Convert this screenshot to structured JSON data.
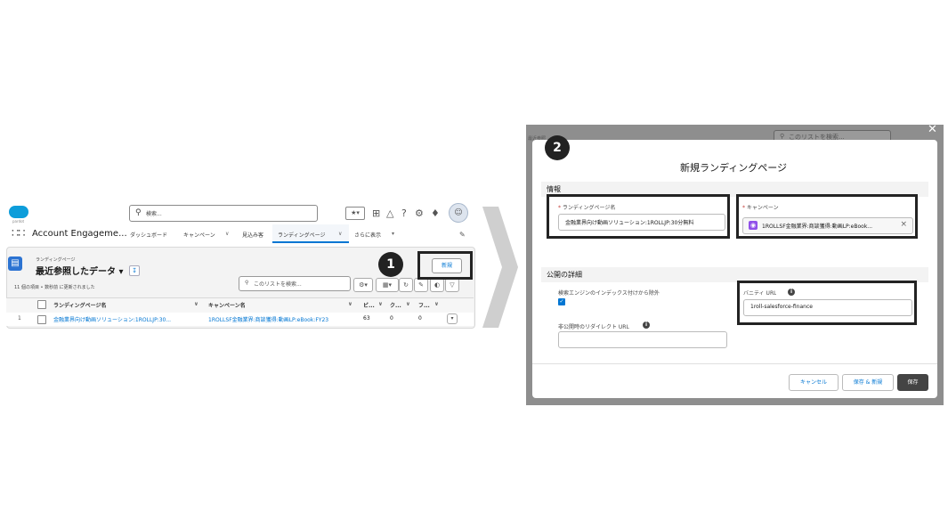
{
  "left_screenshot": {
    "logo_subtext": "pardot",
    "search_placeholder": "検索...",
    "favorites_icon": "star-icon",
    "app_name": "Account Engageme...",
    "nav_items": [
      "ダッシュボード",
      "キャンペーン",
      "見込み客",
      "ランディングページ",
      "さらに表示"
    ],
    "object_type": "ランディングページ",
    "list_view_title": "最近参照したデータ",
    "list_meta": "11 個の項目 • 数秒前 に更新されました",
    "list_search_placeholder": "このリストを検索...",
    "new_button": "新規",
    "step_badge": "1",
    "columns": [
      "ランディングページ名",
      "キャンペーン名",
      "ビ...",
      "ク...",
      "フ..."
    ],
    "rows": [
      {
        "index": "1",
        "name": "金融業界向け動画ソリューション:1ROLLJP:30...",
        "campaign": "1ROLLSF金融業界:商談獲得:動画LP:eBook:FY23",
        "views": "63",
        "clicks": "0",
        "forms": "0"
      }
    ]
  },
  "right_screenshot": {
    "step_badge": "2",
    "modal_title": "新規ランディングページ",
    "background_search_placeholder": "このリストを検索...",
    "background_row_label": "最近参照",
    "section_info": "情報",
    "landing_page_name_label": "ランディングページ名",
    "landing_page_name_value": "金融業界向け動画ソリューション:1ROLLJP:30分無料",
    "campaign_label": "キャンペーン",
    "campaign_value": "1ROLLSF金融業界:商談獲得:動画LP:eBook...",
    "section_publish": "公開の詳細",
    "exclude_search_label": "検索エンジンのインデックス付けから除外",
    "vanity_url_label": "バニティ URL",
    "vanity_url_value": "1roll-salesforce-finance",
    "redirect_url_label": "非公開時のリダイレクト URL",
    "cancel_button": "キャンセル",
    "save_new_button": "保存 & 新規",
    "save_button": "保存"
  },
  "icons": [
    "search-icon",
    "star-icon",
    "add-icon",
    "bell-icon",
    "gear-icon",
    "help-icon",
    "waffle-icon",
    "pencil-icon",
    "pin-icon",
    "close-icon",
    "info-icon",
    "chevron-right-arrow"
  ]
}
